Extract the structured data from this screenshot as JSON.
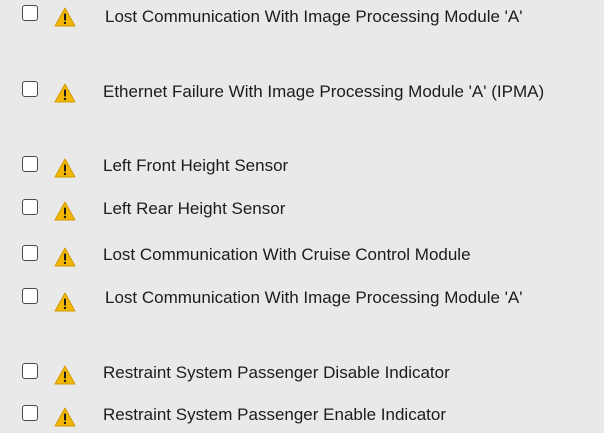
{
  "items": [
    {
      "label": "Lost Communication With Image Processing Module 'A'",
      "checked": false,
      "icon": "warning-icon"
    },
    {
      "label": "Ethernet Failure With Image Processing Module 'A' (IPMA)",
      "checked": false,
      "icon": "warning-icon"
    },
    {
      "label": "Left Front Height Sensor",
      "checked": false,
      "icon": "warning-icon"
    },
    {
      "label": "Left Rear Height Sensor",
      "checked": false,
      "icon": "warning-icon"
    },
    {
      "label": "Lost Communication With Cruise Control Module",
      "checked": false,
      "icon": "warning-icon"
    },
    {
      "label": "Lost Communication With Image Processing Module 'A'",
      "checked": false,
      "icon": "warning-icon"
    },
    {
      "label": "Restraint System Passenger Disable Indicator",
      "checked": false,
      "icon": "warning-icon"
    },
    {
      "label": "Restraint System Passenger Enable Indicator",
      "checked": false,
      "icon": "warning-icon"
    }
  ],
  "colors": {
    "background": "#e9e9e9",
    "warning_fill": "#f2b705",
    "warning_mark": "#1a1a1a",
    "checkbox_border": "#4a4a4a"
  }
}
